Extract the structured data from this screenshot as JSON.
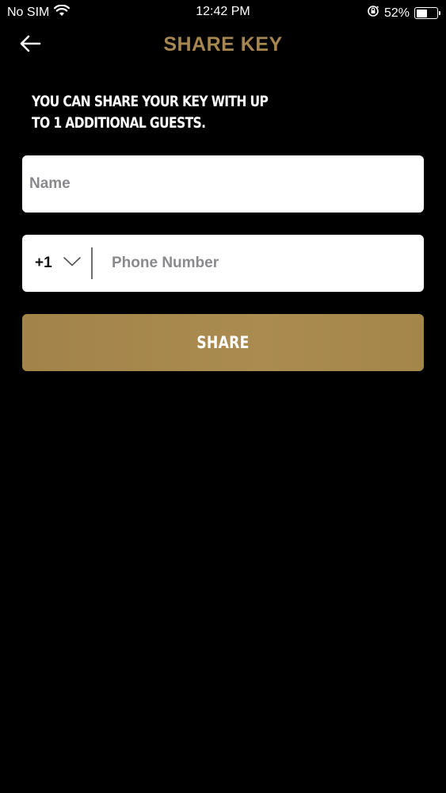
{
  "status_bar": {
    "carrier": "No SIM",
    "time": "12:42 PM",
    "battery_percent": "52%",
    "battery_level": 0.52
  },
  "nav": {
    "title": "SHARE KEY",
    "back_icon": "arrow-left-icon"
  },
  "info": {
    "text": "YOU CAN SHARE YOUR KEY WITH UP TO 1 ADDITIONAL GUESTS."
  },
  "form": {
    "name_placeholder": "Name",
    "name_value": "",
    "country_code": "+1",
    "phone_placeholder": "Phone Number",
    "phone_value": ""
  },
  "share_button": {
    "label": "SHARE"
  },
  "colors": {
    "background": "#000000",
    "accent": "#a5864a",
    "title": "#a58550",
    "field_bg": "#ffffff"
  }
}
